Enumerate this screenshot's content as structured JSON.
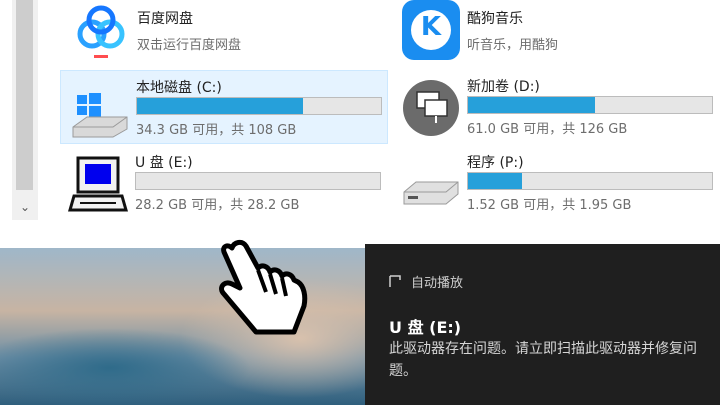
{
  "drives": {
    "baidu": {
      "name": "百度网盘",
      "sub": "双击运行百度网盘"
    },
    "kugou": {
      "name": "酷狗音乐",
      "sub": "听音乐，用酷狗"
    },
    "c": {
      "name": "本地磁盘 (C:)",
      "sub": "34.3 GB 可用，共 108 GB",
      "used_fraction": 0.68
    },
    "d": {
      "name": "新加卷 (D:)",
      "sub": "61.0 GB 可用，共 126 GB",
      "used_fraction": 0.52
    },
    "e": {
      "name": "U 盘 (E:)",
      "sub": "28.2 GB 可用，共 28.2 GB",
      "used_fraction": 0.0
    },
    "p": {
      "name": "程序 (P:)",
      "sub": "1.52 GB 可用，共 1.95 GB",
      "used_fraction": 0.22
    }
  },
  "kugou_logo_letter": "K",
  "toast": {
    "app": "自动播放",
    "title": "U 盘 (E:)",
    "body": "此驱动器存在问题。请立即扫描此驱动器并修复问题。"
  },
  "colors": {
    "bar_fill": "#26a0da",
    "selected_bg": "#e5f3ff",
    "toast_bg": "#1f1f1f",
    "kugou_blue": "#1a8df0"
  },
  "icons": [
    "baidu-netdisk-icon",
    "kugou-icon",
    "windows-drive-icon",
    "network-drive-icon",
    "usb-drive-computer-icon",
    "drive-icon",
    "hand-cursor-icon"
  ]
}
